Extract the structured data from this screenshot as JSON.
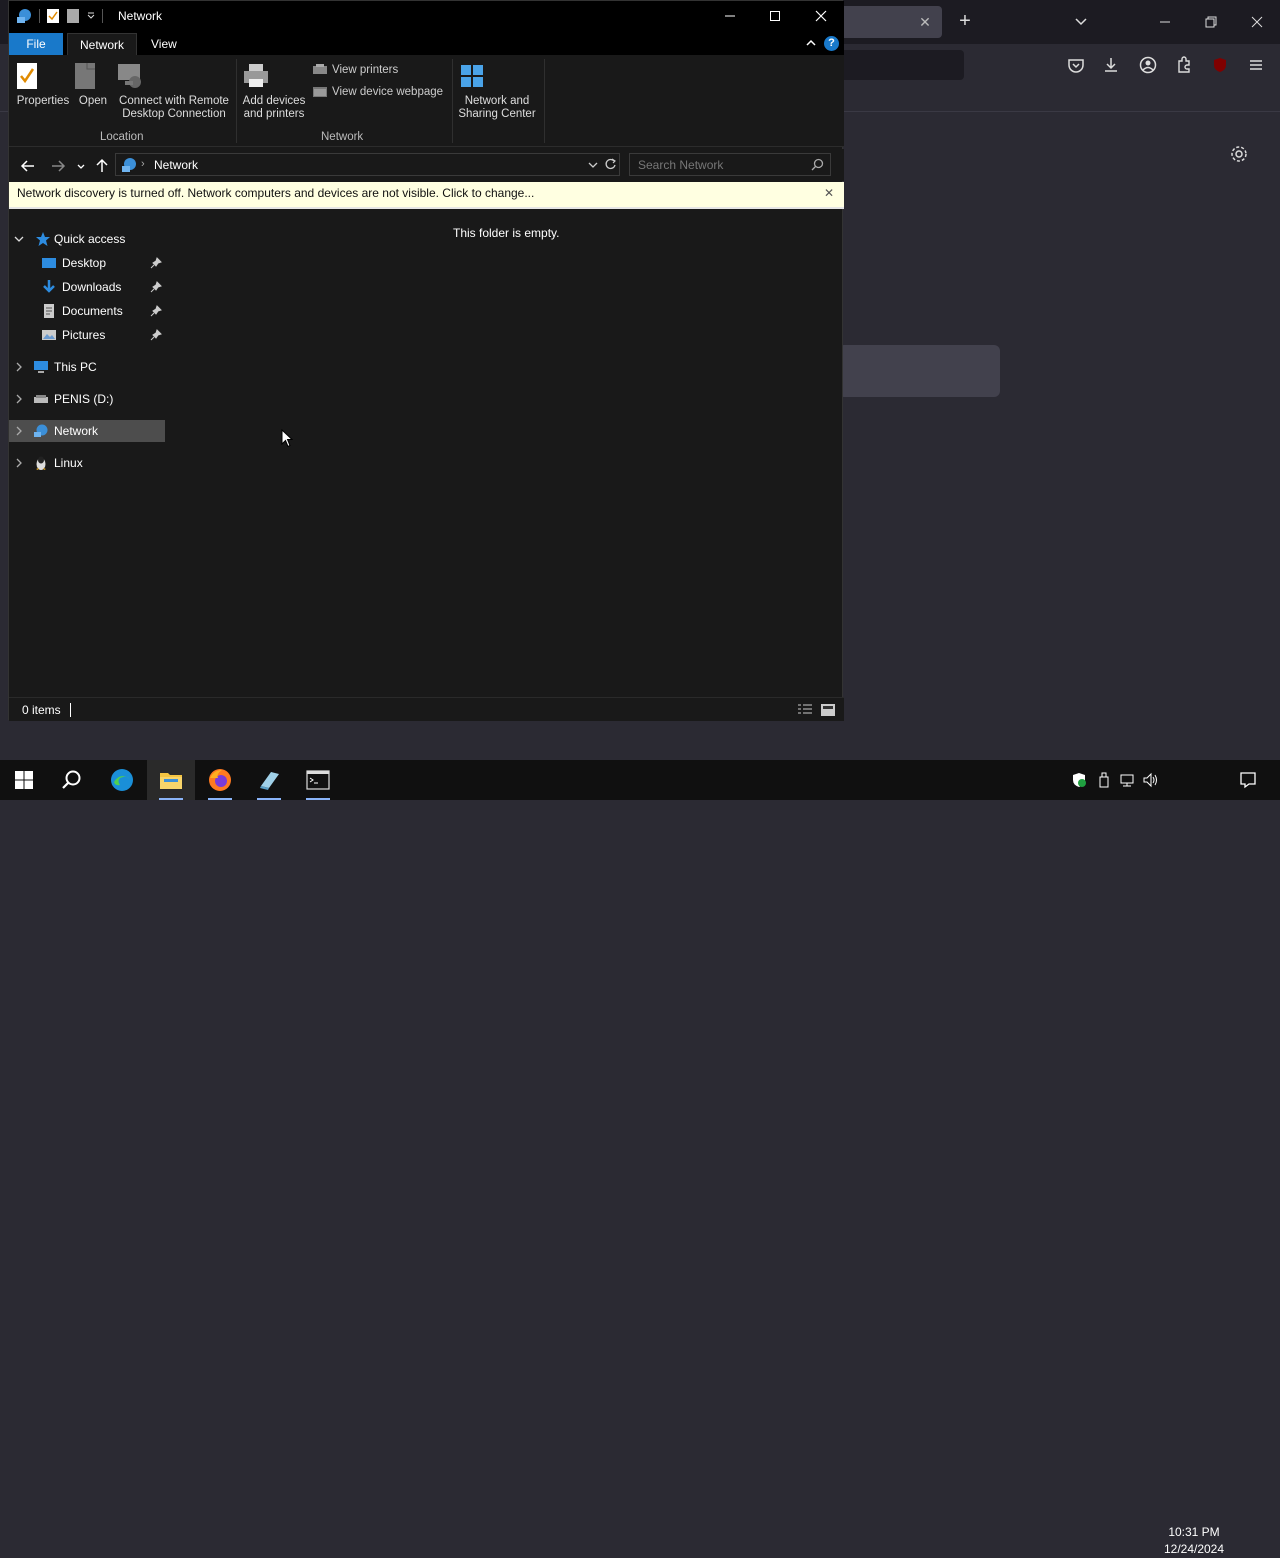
{
  "window": {
    "title": "Network",
    "tabs": [
      {
        "label": "File"
      },
      {
        "label": "Network"
      },
      {
        "label": "View"
      }
    ]
  },
  "ribbon": {
    "properties": "Properties",
    "open": "Open",
    "connect_line1": "Connect with Remote",
    "connect_line2": "Desktop Connection",
    "add_devices_line1": "Add devices",
    "add_devices_line2": "and printers",
    "view_printers": "View printers",
    "view_device_webpage": "View device webpage",
    "network_sharing_line1": "Network and",
    "network_sharing_line2": "Sharing Center",
    "group_location": "Location",
    "group_network": "Network"
  },
  "address": {
    "path": "Network",
    "search_placeholder": "Search Network"
  },
  "infobar": {
    "text": "Network discovery is turned off. Network computers and devices are not visible. Click to change..."
  },
  "nav_pane": {
    "quick_access": "Quick access",
    "quick_items": [
      {
        "label": "Desktop"
      },
      {
        "label": "Downloads"
      },
      {
        "label": "Documents"
      },
      {
        "label": "Pictures"
      }
    ],
    "this_pc": "This PC",
    "drive": "PENIS (D:)",
    "network": "Network",
    "linux": "Linux"
  },
  "content": {
    "empty_message": "This folder is empty."
  },
  "status": {
    "items": "0 items"
  },
  "taskbar": {
    "apps": [
      "start-icon",
      "search-icon",
      "edge-icon",
      "file-explorer-icon",
      "firefox-icon",
      "notepad-icon",
      "terminal-icon"
    ],
    "time": "10:31 PM",
    "date": "12/24/2024"
  },
  "colors": {
    "accent": "#1979ca",
    "infobar_bg": "#ffffe1",
    "explorer_bg": "#191919",
    "browser_bg": "#2b2a33"
  }
}
